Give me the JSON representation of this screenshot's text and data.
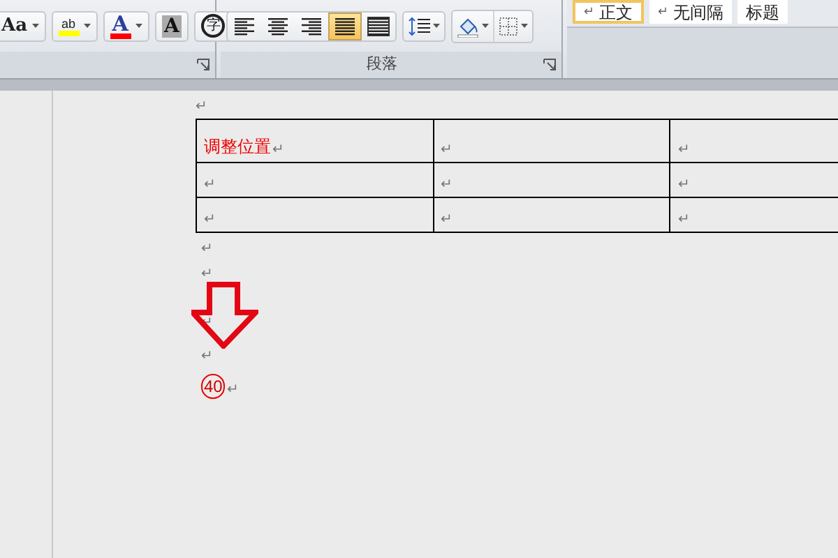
{
  "ribbon": {
    "font_group": {
      "buttons": [
        {
          "kind": "case",
          "label": "Aa",
          "dropdown": true
        },
        {
          "kind": "highlight",
          "label": "ab",
          "dropdown": true,
          "color": "#ffff00"
        },
        {
          "kind": "font-color",
          "label": "A",
          "dropdown": true,
          "color": "#ff0000"
        },
        {
          "kind": "shade",
          "label": "A",
          "dropdown": false
        },
        {
          "kind": "enclose",
          "label": "字",
          "dropdown": false
        }
      ]
    },
    "paragraph_group": {
      "label": "段落",
      "align_buttons": [
        {
          "kind": "left",
          "selected": false
        },
        {
          "kind": "center",
          "selected": false
        },
        {
          "kind": "right",
          "selected": false
        },
        {
          "kind": "justify",
          "selected": true
        },
        {
          "kind": "distributed",
          "selected": false
        }
      ],
      "tools": [
        {
          "kind": "line-spacing"
        },
        {
          "kind": "shading"
        },
        {
          "kind": "borders"
        }
      ]
    },
    "styles": [
      {
        "mark": "↵",
        "label": "正文",
        "selected": true
      },
      {
        "mark": "↵",
        "label": "无间隔",
        "selected": false
      },
      {
        "label": "标题",
        "selected": false
      }
    ]
  },
  "document": {
    "before_table": [
      {
        "mark": "↵"
      }
    ],
    "table": {
      "rows": [
        [
          {
            "text": "调整位置",
            "mark": "↵"
          },
          {
            "mark": "↵"
          },
          {
            "mark": "↵"
          }
        ],
        [
          {
            "mark": "↵"
          },
          {
            "mark": "↵"
          },
          {
            "mark": "↵"
          }
        ],
        [
          {
            "mark": "↵"
          },
          {
            "mark": "↵"
          },
          {
            "mark": "↵"
          }
        ]
      ]
    },
    "after_table": [
      {
        "mark": "↵"
      },
      {
        "mark": "↵"
      },
      {
        "mark": "↵"
      },
      {
        "mark": "↵"
      },
      {
        "text": "40",
        "circled": true,
        "mark": "↵"
      }
    ]
  }
}
